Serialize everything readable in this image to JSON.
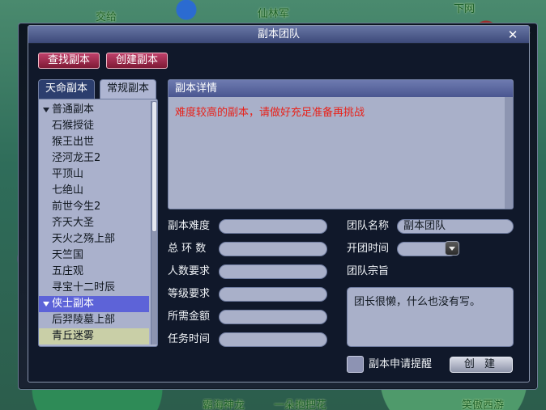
{
  "window": {
    "title": "副本团队",
    "close_symbol": "✕"
  },
  "toolbar": {
    "find_label": "查找副本",
    "create_label": "创建副本"
  },
  "tabs": [
    {
      "label": "天命副本",
      "active": false
    },
    {
      "label": "常规副本",
      "active": true
    }
  ],
  "tree": {
    "groups": [
      {
        "label": "普通副本",
        "expanded": true
      },
      {
        "label": "侠士副本",
        "expanded": true,
        "selected": true
      }
    ],
    "normal_items": [
      "石猴授徒",
      "猴王出世",
      "泾河龙王2",
      "平顶山",
      "七绝山",
      "前世今生2",
      "齐天大圣",
      "天火之殇上部",
      "天竺国",
      "五庄观",
      "寻宝十二时辰"
    ],
    "hero_items": [
      "后羿陵墓上部",
      "青丘迷雾"
    ]
  },
  "details": {
    "header": "副本详情",
    "text": "难度较高的副本，请做好充足准备再挑战"
  },
  "form": {
    "difficulty_label": "副本难度",
    "rings_label": "总 环 数",
    "people_label": "人数要求",
    "level_label": "等级要求",
    "money_label": "所需金额",
    "time_label": "任务时间",
    "team_name_label": "团队名称",
    "team_name_value": "副本团队",
    "open_time_label": "开团时间",
    "motto_label": "团队宗旨",
    "motto_value": "团长很懒，什么也没有写。",
    "remind_label": "副本申请提醒",
    "create_button": "创 建"
  },
  "world": {
    "texts": [
      "交给",
      "仙林军",
      "霸海神龙",
      "一朵抱把花",
      "笑傲西游",
      "下网"
    ]
  },
  "colors": {
    "title_bar": "#4d5a8c",
    "panel": "#a9b0c9",
    "selected_row": "#5d63d8",
    "warning_text": "#e8221a",
    "pink_button": "#9c2448"
  }
}
